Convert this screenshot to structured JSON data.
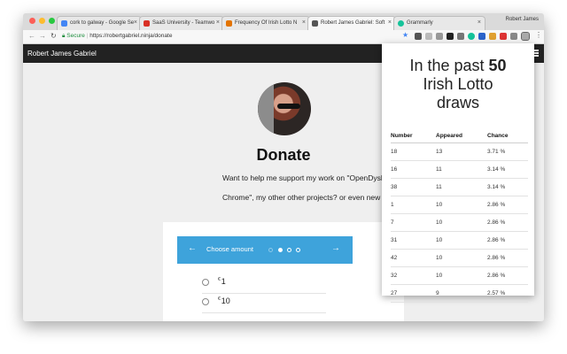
{
  "tabs": [
    {
      "title": "cork to galway - Google Se",
      "color": "#4285f4"
    },
    {
      "title": "SaaS University - Teamwo",
      "color": "#d93025"
    },
    {
      "title": "Frequency Of Irish Lotto N",
      "color": "#e37400"
    },
    {
      "title": "Robert James Gabriel: Soft",
      "color": "#555555"
    },
    {
      "title": "Grammarly",
      "color": "#15c39a"
    }
  ],
  "profile_name": "Robert James",
  "address": {
    "secure_label": "Secure",
    "url": "https://robertgabriel.ninja/donate"
  },
  "site": {
    "brand": "Robert James Gabriel"
  },
  "page": {
    "heading": "Donate",
    "intro_line1": "Want to help me support my work on \"OpenDyslexic F",
    "intro_line2": "Chrome\", my other other projects? or even new project"
  },
  "donation": {
    "title": "Choose amount",
    "back_arrow": "←",
    "next_arrow": "→",
    "steps": 4,
    "active_step": 2,
    "currency": "€",
    "options": [
      "1",
      "10"
    ]
  },
  "popup": {
    "title_prefix": "In the past",
    "title_number": "50",
    "title_suffix_1": "Irish Lotto",
    "title_suffix_2": "draws",
    "columns": [
      "Number",
      "Appeared",
      "Chance"
    ],
    "rows": [
      [
        "18",
        "13",
        "3.71 %"
      ],
      [
        "16",
        "11",
        "3.14 %"
      ],
      [
        "38",
        "11",
        "3.14 %"
      ],
      [
        "1",
        "10",
        "2.86 %"
      ],
      [
        "7",
        "10",
        "2.86 %"
      ],
      [
        "31",
        "10",
        "2.86 %"
      ],
      [
        "42",
        "10",
        "2.86 %"
      ],
      [
        "32",
        "10",
        "2.86 %"
      ],
      [
        "27",
        "9",
        "2.57 %"
      ]
    ]
  }
}
